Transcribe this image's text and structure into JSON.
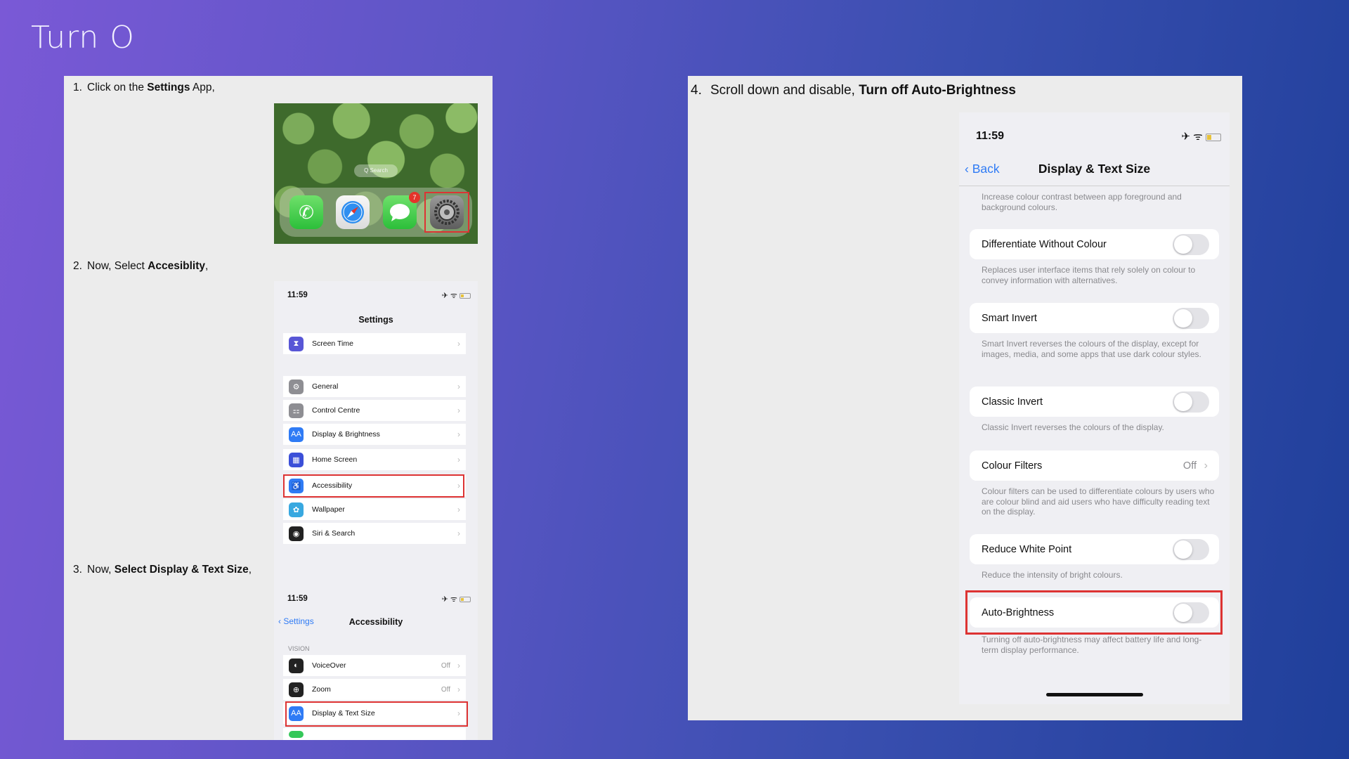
{
  "slide": {
    "title": "Turn O"
  },
  "steps": {
    "s1": {
      "num": "1.",
      "pre": "Click on the ",
      "bold": "Settings",
      "post": " App,"
    },
    "s2": {
      "num": "2.",
      "pre": "Now, Select ",
      "bold": "Accesiblity",
      "post": ","
    },
    "s3": {
      "num": "3.",
      "pre": "Now, ",
      "bold": "Select Display & Text Size",
      "post": ","
    },
    "s4": {
      "num": "4.",
      "pre": "Scroll down and disable, ",
      "bold": "Turn off Auto-Brightness",
      "post": ""
    }
  },
  "home_screen": {
    "search_label": "Q Search",
    "messages_badge": "7",
    "apps": [
      "phone-icon",
      "safari-icon",
      "messages-icon",
      "settings-icon"
    ]
  },
  "settings_screen": {
    "time": "11:59",
    "title": "Settings",
    "items": [
      {
        "label": "Screen Time",
        "icon": "hourglass-icon",
        "color": "#5856d6"
      },
      {
        "label": "General",
        "icon": "gear-icon",
        "color": "#8e8e93"
      },
      {
        "label": "Control Centre",
        "icon": "switches-icon",
        "color": "#8e8e93"
      },
      {
        "label": "Display & Brightness",
        "icon": "aa-icon",
        "color": "#2f7bf5"
      },
      {
        "label": "Home Screen",
        "icon": "grid-icon",
        "color": "#3b4fd8"
      },
      {
        "label": "Accessibility",
        "icon": "accessibility-icon",
        "color": "#2f7bf5"
      },
      {
        "label": "Wallpaper",
        "icon": "flower-icon",
        "color": "#38a8e0"
      },
      {
        "label": "Siri & Search",
        "icon": "siri-icon",
        "color": "#222222"
      }
    ]
  },
  "accessibility_screen": {
    "time": "11:59",
    "back": "Settings",
    "title": "Accessibility",
    "section": "VISION",
    "items": [
      {
        "label": "VoiceOver",
        "value": "Off",
        "icon": "voiceover-icon"
      },
      {
        "label": "Zoom",
        "value": "Off",
        "icon": "zoom-icon"
      },
      {
        "label": "Display & Text Size",
        "value": "",
        "icon": "aa-icon"
      }
    ]
  },
  "display_text_screen": {
    "time": "11:59",
    "back": "Back",
    "title": "Display & Text Size",
    "top_desc": "Increase colour contrast between app foreground and background colours.",
    "rows": [
      {
        "label": "Differentiate Without Colour",
        "desc": "Replaces user interface items that rely solely on colour to convey information with alternatives."
      },
      {
        "label": "Smart Invert",
        "desc": "Smart Invert reverses the colours of the display, except for images, media, and some apps that use dark colour styles."
      },
      {
        "label": "Classic Invert",
        "desc": "Classic Invert reverses the colours of the display."
      },
      {
        "label": "Colour Filters",
        "value": "Off",
        "desc": "Colour filters can be used to differentiate colours by users who are colour blind and aid users who have difficulty reading text on the display."
      },
      {
        "label": "Reduce White Point",
        "desc": "Reduce the intensity of bright colours."
      },
      {
        "label": "Auto-Brightness",
        "desc": "Turning off auto-brightness may affect battery life and long-term display performance."
      }
    ]
  },
  "colors": {
    "highlight": "#dd3333",
    "ios_blue": "#2f7bf5",
    "panel": "#ececec"
  }
}
